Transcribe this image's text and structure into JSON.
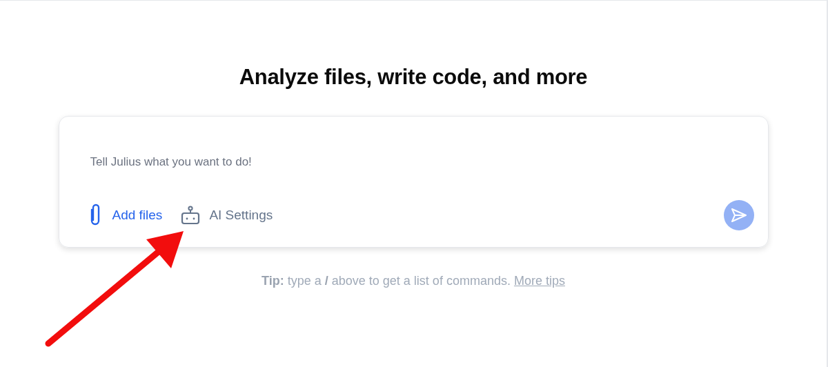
{
  "heading": "Analyze files, write code, and more",
  "prompt": {
    "placeholder": "Tell Julius what you want to do!"
  },
  "actions": [
    {
      "kind": "attach",
      "label": "Add files"
    },
    {
      "kind": "robot",
      "label": "AI Settings"
    }
  ],
  "send_button": {
    "disabled": true
  },
  "tip": {
    "text": "**Tip:** type a **/** above to get a list of commands.",
    "link": "More tips"
  }
}
